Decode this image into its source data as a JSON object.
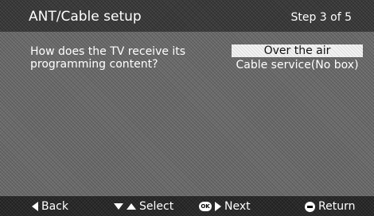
{
  "header": {
    "title": "ANT/Cable setup",
    "step": "Step 3 of 5"
  },
  "question": "How does the TV receive its programming content?",
  "options": [
    {
      "label": "Over the air",
      "selected": true
    },
    {
      "label": "Cable service(No box)",
      "selected": false
    }
  ],
  "footer": {
    "back": {
      "icon": "triangle-left-icon",
      "label": "Back"
    },
    "select": {
      "icon": "updown-arrows-icon",
      "label": "Select"
    },
    "next": {
      "icon": "ok-button-icon",
      "ok_text": "OK",
      "label": "Next"
    },
    "return": {
      "icon": "return-button-icon",
      "label": "Return"
    }
  },
  "colors": {
    "background": "#6c6c6c",
    "header": "#3c3c3c",
    "footer": "#2a2a2a",
    "highlight": "#f4f4f4"
  }
}
